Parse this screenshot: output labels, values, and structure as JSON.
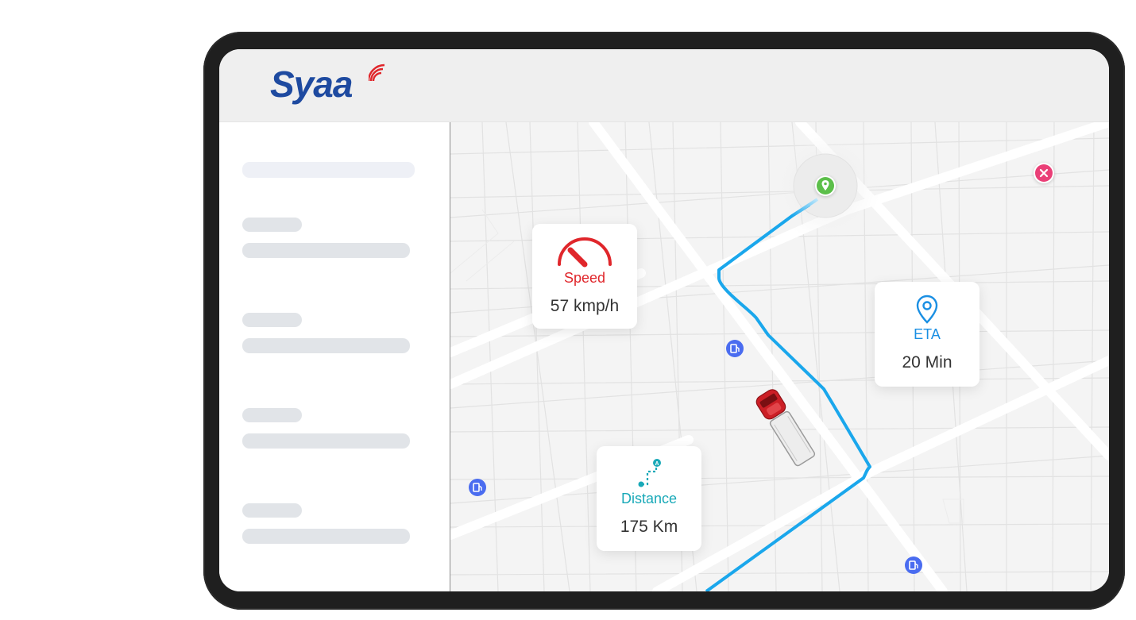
{
  "brand": {
    "name": "Syaa",
    "color": "#1e4aa0",
    "accent": "#e0262b"
  },
  "map": {
    "route_color": "#1aa7ec",
    "stats": {
      "speed": {
        "label": "Speed",
        "value": "57 kmp/h",
        "color": "#e0262b",
        "icon": "speedometer-icon"
      },
      "eta": {
        "label": "ETA",
        "value": "20 Min",
        "color": "#1a8fe3",
        "icon": "location-pin-icon"
      },
      "distance": {
        "label": "Distance",
        "value": "175 Km",
        "color": "#19a9b8",
        "icon": "route-icon"
      }
    },
    "markers": {
      "destination": {
        "icon": "destination-pin-icon",
        "color": "#5cbf4a"
      },
      "blocked": {
        "icon": "close-icon",
        "color": "#ea3f77"
      },
      "fuel": {
        "icon": "fuel-station-icon",
        "color": "#4a6cf0"
      },
      "vehicle": {
        "icon": "truck-icon",
        "color": "#cc1f26"
      }
    }
  }
}
